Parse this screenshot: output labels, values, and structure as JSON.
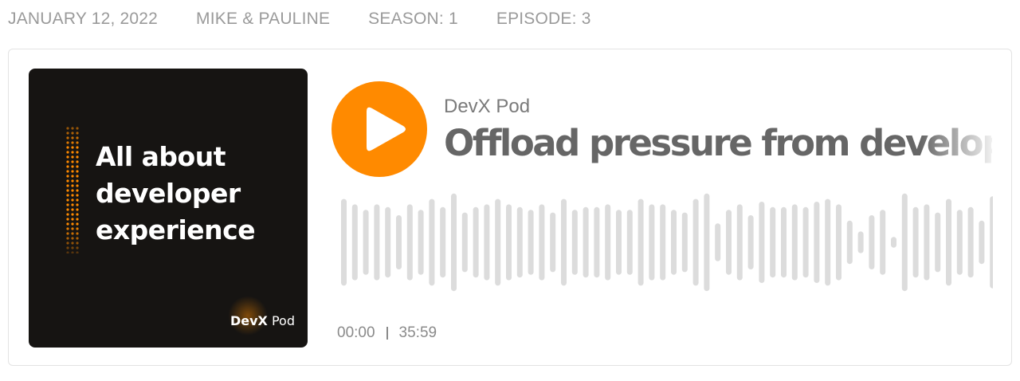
{
  "meta": {
    "date": "JANUARY 12, 2022",
    "hosts": "MIKE & PAULINE",
    "season": "SEASON: 1",
    "episode": "EPISODE: 3"
  },
  "cover": {
    "title_lines": [
      "All about",
      "developer",
      "experience"
    ],
    "logo_bold": "DevX",
    "logo_rest": " Pod",
    "background_color": "#161412",
    "accent_color": "#ff8a00"
  },
  "player": {
    "play_icon": "play-icon",
    "play_color": "#ff8a00",
    "show_name": "DevX Pod",
    "episode_title": "Offload pressure from developers",
    "current_time": "00:00",
    "duration": "35:59",
    "progress": 0,
    "waveform_color": "#dcdcdc"
  }
}
